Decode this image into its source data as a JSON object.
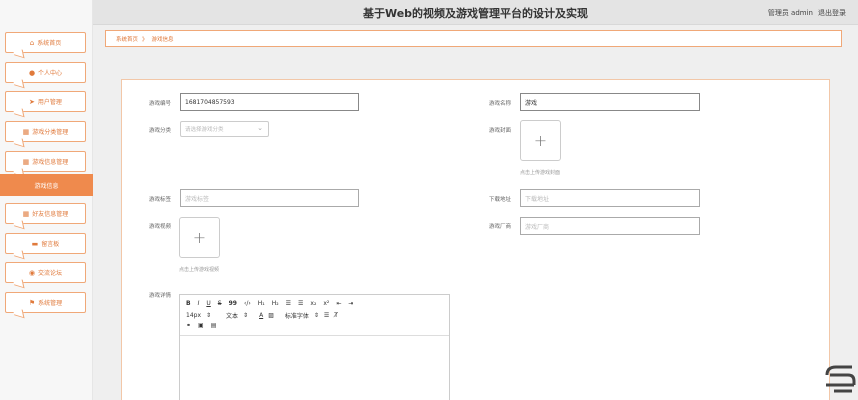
{
  "header": {
    "title": "基于Web的视频及游戏管理平台的设计及实现",
    "user": "管理员 admin",
    "logout": "退出登录"
  },
  "sidebar": {
    "items": [
      {
        "label": "系统首页",
        "icon": "home-icon"
      },
      {
        "label": "个人中心",
        "icon": "user-icon"
      },
      {
        "label": "用户管理",
        "icon": "send-icon"
      },
      {
        "label": "游戏分类管理",
        "icon": "grid-icon"
      },
      {
        "label": "游戏信息管理",
        "icon": "grid-icon"
      },
      {
        "label": "好友信息管理",
        "icon": "grid-icon"
      },
      {
        "label": "留言板",
        "icon": "message-icon"
      },
      {
        "label": "交流论坛",
        "icon": "forum-icon"
      },
      {
        "label": "系统管理",
        "icon": "flag-icon"
      }
    ],
    "active": "游戏信息"
  },
  "breadcrumb": {
    "home": "系统首页",
    "sep": "》",
    "current": "游戏信息"
  },
  "form": {
    "game_no_label": "游戏编号",
    "game_no_value": "1681704857593",
    "game_name_label": "游戏名称",
    "game_name_value": "游戏",
    "category_label": "游戏分类",
    "category_placeholder": "请选择游戏分类",
    "cover_label": "游戏封面",
    "cover_hint": "点击上传游戏封面",
    "tags_label": "游戏标签",
    "tags_placeholder": "游戏标签",
    "download_label": "下载地址",
    "download_placeholder": "下载地址",
    "video_label": "游戏视频",
    "video_hint": "点击上传游戏视频",
    "vendor_label": "游戏厂商",
    "vendor_placeholder": "游戏厂商",
    "detail_label": "游戏详情"
  },
  "editor": {
    "row1": [
      "B",
      "I",
      "U",
      "S",
      "99",
      "‹/›",
      "H₁",
      "H₂",
      "☰",
      "☰",
      "x₂",
      "x²",
      "⇤",
      "⇥"
    ],
    "font_size": "14px",
    "text_type": "文本",
    "font_family": "标准字体",
    "row3": [
      "🔗",
      "▣",
      "▤"
    ]
  },
  "colors": {
    "accent": "#ef8a4d",
    "border_accent": "#f0a878"
  }
}
